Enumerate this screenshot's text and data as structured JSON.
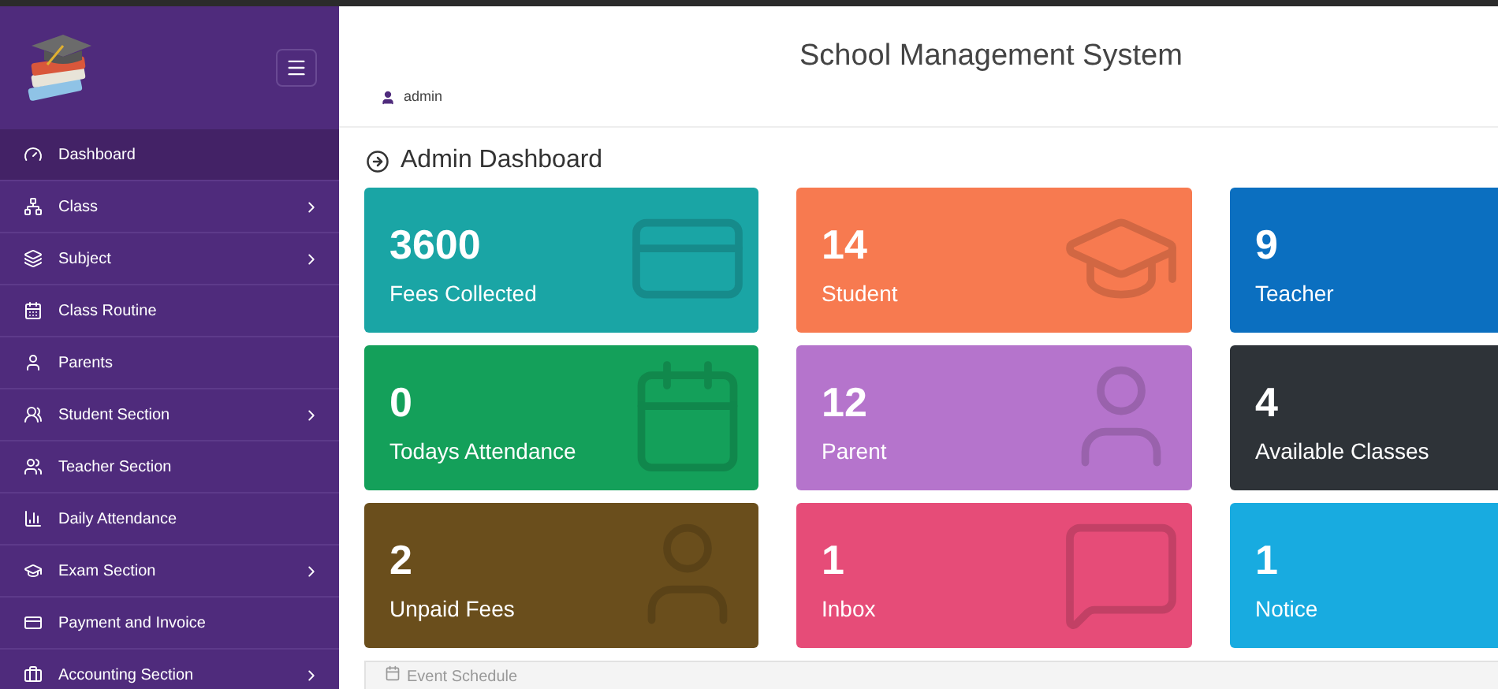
{
  "sidebar": {
    "items": [
      {
        "label": "Dashboard",
        "selected": true,
        "submenu": false
      },
      {
        "label": "Class",
        "selected": false,
        "submenu": true
      },
      {
        "label": "Subject",
        "selected": false,
        "submenu": true
      },
      {
        "label": "Class Routine",
        "selected": false,
        "submenu": false
      },
      {
        "label": "Parents",
        "selected": false,
        "submenu": false
      },
      {
        "label": "Student Section",
        "selected": false,
        "submenu": true
      },
      {
        "label": "Teacher Section",
        "selected": false,
        "submenu": false
      },
      {
        "label": "Daily Attendance",
        "selected": false,
        "submenu": false
      },
      {
        "label": "Exam Section",
        "selected": false,
        "submenu": true
      },
      {
        "label": "Payment and Invoice",
        "selected": false,
        "submenu": false
      },
      {
        "label": "Accounting Section",
        "selected": false,
        "submenu": true
      }
    ]
  },
  "header": {
    "title": "School Management System",
    "user": "admin"
  },
  "page_title": "Admin Dashboard",
  "cards": [
    {
      "value": "3600",
      "label": "Fees Collected",
      "color": "#1aa5a5"
    },
    {
      "value": "14",
      "label": "Student",
      "color": "#f77a50"
    },
    {
      "value": "9",
      "label": "Teacher",
      "color": "#0b6fc0"
    },
    {
      "value": "0",
      "label": "Todays Attendance",
      "color": "#14a05a"
    },
    {
      "value": "12",
      "label": "Parent",
      "color": "#b574cc"
    },
    {
      "value": "4",
      "label": "Available Classes",
      "color": "#2e3338"
    },
    {
      "value": "2",
      "label": "Unpaid Fees",
      "color": "#6a4e1c"
    },
    {
      "value": "1",
      "label": "Inbox",
      "color": "#e64c78"
    },
    {
      "value": "1",
      "label": "Notice",
      "color": "#18abe0"
    }
  ],
  "event_panel": {
    "title": "Event Schedule"
  }
}
